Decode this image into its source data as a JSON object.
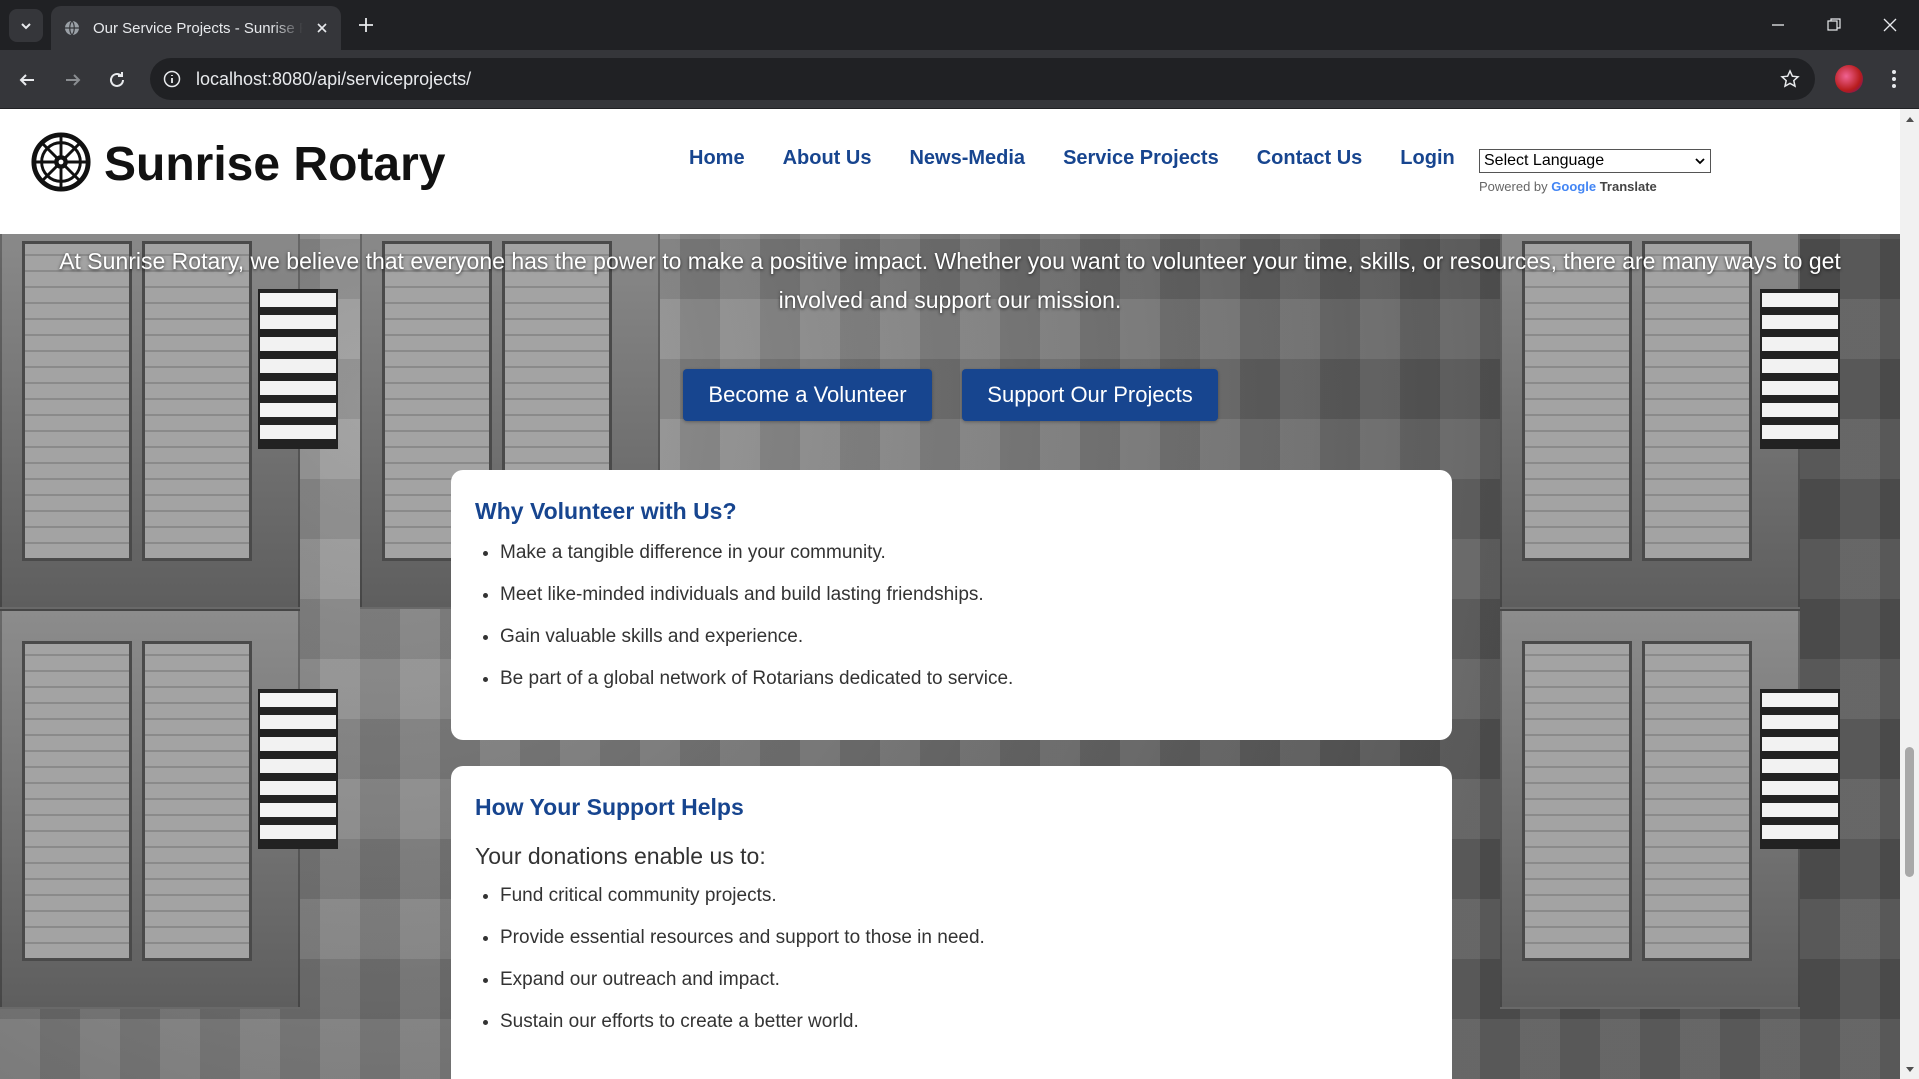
{
  "browser": {
    "tab_title": "Our Service Projects - Sunrise Rotary",
    "url": "localhost:8080/api/serviceprojects/"
  },
  "site": {
    "brand": "Sunrise Rotary",
    "nav": [
      "Home",
      "About Us",
      "News-Media",
      "Service Projects",
      "Contact Us",
      "Login"
    ],
    "language_select": "Select Language",
    "powered_by": "Powered by",
    "google": "Google",
    "translate": "Translate"
  },
  "intro": {
    "text": "At Sunrise Rotary, we believe that everyone has the power to make a positive impact. Whether you want to volunteer your time, skills, or resources, there are many ways to get involved and support our mission."
  },
  "buttons": {
    "volunteer": "Become a Volunteer",
    "support": "Support Our Projects"
  },
  "why_volunteer": {
    "heading": "Why Volunteer with Us?",
    "items": [
      "Make a tangible difference in your community.",
      "Meet like-minded individuals and build lasting friendships.",
      "Gain valuable skills and experience.",
      "Be part of a global network of Rotarians dedicated to service."
    ]
  },
  "support_helps": {
    "heading": "How Your Support Helps",
    "lead": "Your donations enable us to:",
    "items": [
      "Fund critical community projects.",
      "Provide essential resources and support to those in need.",
      "Expand our outreach and impact.",
      "Sustain our efforts to create a better world."
    ]
  },
  "colors": {
    "brand_blue": "#17458f",
    "chrome_dark": "#202124",
    "chrome_toolbar": "#35363a"
  }
}
